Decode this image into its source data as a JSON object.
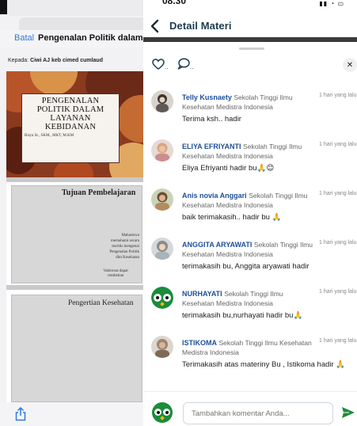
{
  "left_app": {
    "cancel_label": "Batal",
    "doc_title": "Pengenalan Politik dalam...",
    "recipient_prefix": "Kepada:",
    "recipient_name": "Ciwi AJ keb cimed cumlaud",
    "cover_title": "PENGENALAN POLITIK DALAM LAYANAN KEBIDANAN",
    "cover_author": "Risya Sr., SKM., MKT, M.KM",
    "page2_heading": "Tujuan Pembelajaran",
    "page2_column_text": "Mahasiswa memahami secara teoritis mengenai Pengenalan Politik dlm Kesehatan",
    "page2_column_text2": "Vaktorsas dapat cembetian",
    "page3_heading": "Pengertian Kesehatan"
  },
  "status_bar": {
    "time": "08.30"
  },
  "header": {
    "title": "Detail Materi"
  },
  "actions": {
    "like_count": "..",
    "comment_count": ".."
  },
  "comments": [
    {
      "name": "Telly Kusnaety",
      "institution": "Sekolah Tinggi Ilmu Kesehatan Medistra Indonesia",
      "time": "1 hari yang lalu",
      "message": "Terima ksh.. hadir"
    },
    {
      "name": "ELIYA EFRIYANTI",
      "institution": "Sekolah Tinggi Ilmu Kesehatan Medistra Indonesia",
      "time": "1 hari yang lalu",
      "message": "Eliya Efriyanti hadir bu🙏😊"
    },
    {
      "name": "Anis novia Anggari",
      "institution": "Sekolah Tinggi Ilmu Kesehatan Medistra Indonesia",
      "time": "1 hari yang lalu",
      "message": "baik terimakasih.. hadir bu 🙏"
    },
    {
      "name": "ANGGITA ARYAWATI",
      "institution": "Sekolah Tinggi Ilmu Kesehatan Medistra Indonesia",
      "time": "1 hari yang lalu",
      "message": "terimakasih bu, Anggita aryawati hadir"
    },
    {
      "name": "NURHAYATI",
      "institution": "Sekolah Tinggi Ilmu Kesehatan Medistra Indonesia",
      "time": "1 hari yang lalu",
      "message": "terimakasih bu,nurhayati hadir bu🙏"
    },
    {
      "name": "ISTIKOMA",
      "institution": "Sekolah Tinggi Ilmu Kesehatan Medistra Indonesia",
      "time": "1 hari yang lalu",
      "message": "Terimakasih atas materiny Bu , Istikoma hadir 🙏"
    }
  ],
  "composer": {
    "placeholder": "Tambahkan komentar Anda..."
  },
  "colors": {
    "accent": "#1e4f9a",
    "send": "#1a8c3c",
    "header_text": "#1d3c4d",
    "cancel_link": "#2f7ad8"
  }
}
